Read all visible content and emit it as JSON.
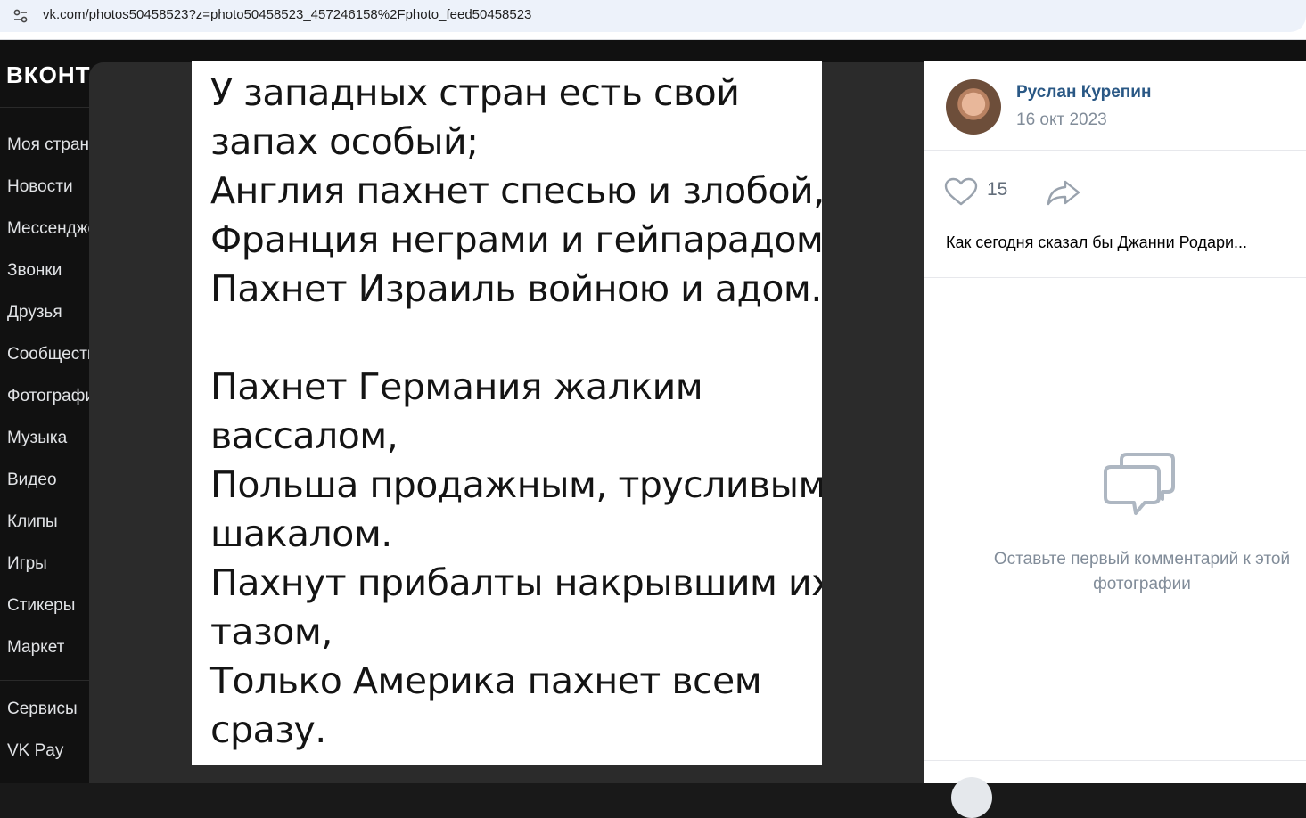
{
  "browser": {
    "url": "vk.com/photos50458523?z=photo50458523_457246158%2Fphoto_feed50458523",
    "site_info_icon": "tune-icon"
  },
  "vk": {
    "logo": "ВКОНТАКТЕ",
    "nav_items": [
      "Моя страница",
      "Новости",
      "Мессенджер",
      "Звонки",
      "Друзья",
      "Сообщества",
      "Фотографии",
      "Музыка",
      "Видео",
      "Клипы",
      "Игры",
      "Стикеры",
      "Маркет"
    ],
    "nav_items_secondary": [
      "Сервисы",
      "VK Pay"
    ]
  },
  "photo": {
    "lines": [
      "У западных стран есть свой",
      "запах особый;",
      "Англия пахнет спесью и злобой,",
      "Франция неграми и гейпарадом,",
      "Пахнет Израиль войною и адом.",
      "",
      "Пахнет Германия жалким",
      "вассалом,",
      "Польша продажным, трусливым",
      "шакалом.",
      "Пахнут прибалты накрывшим их",
      "тазом,",
      "Только Америка пахнет всем",
      "сразу."
    ]
  },
  "side": {
    "author": "Руслан Курепин",
    "date": "16 окт 2023",
    "likes": "15",
    "like_icon": "heart-icon",
    "share_icon": "share-arrow-icon",
    "caption": "Как сегодня сказал бы Джанни Родари...",
    "comments_icon": "comments-icon",
    "comments_hint": "Оставьте первый комментарий к этой фотографии"
  }
}
